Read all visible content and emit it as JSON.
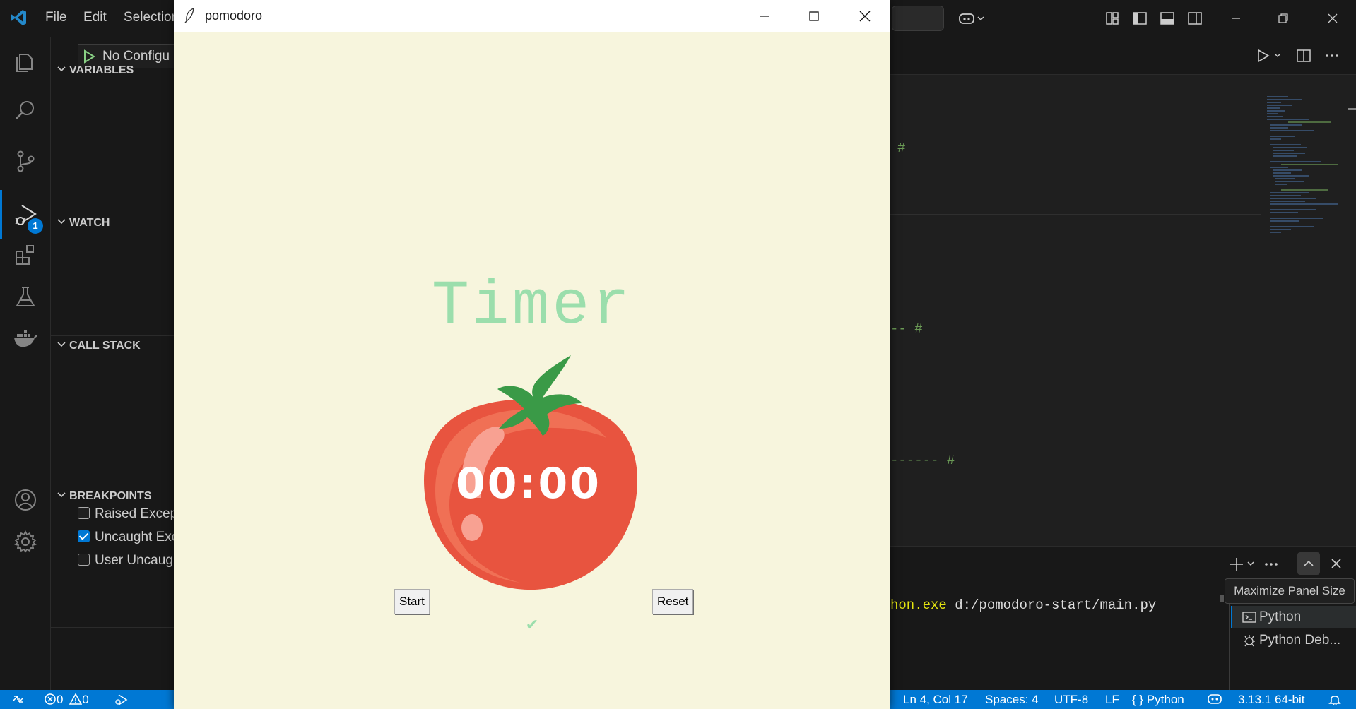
{
  "vscode": {
    "menu": [
      "File",
      "Edit",
      "Selection"
    ],
    "run_config": "No Configu",
    "sidebar": {
      "variables": "VARIABLES",
      "watch": "WATCH",
      "call_stack": "CALL STACK",
      "breakpoints": "BREAKPOINTS",
      "breakpoint_items": [
        {
          "label": "Raised Excep",
          "checked": false
        },
        {
          "label": "Uncaught Exc",
          "checked": true
        },
        {
          "label": "User Uncaug",
          "checked": false
        }
      ]
    },
    "activity_badge": "1",
    "editor_fragments": [
      "#",
      "-- #",
      "------ #"
    ],
    "terminal": {
      "command_exe": "hon.exe",
      "command_arg": " d:/pomodoro-start/main.py",
      "tooltip": "Maximize Panel Size",
      "items": [
        "Python",
        "Python Deb..."
      ]
    },
    "status": {
      "errors": "0",
      "warnings": "0",
      "position": "Ln 4, Col 17",
      "spaces": "Spaces: 4",
      "encoding": "UTF-8",
      "eol": "LF",
      "language": "Python",
      "interpreter": "3.13.1 64-bit"
    }
  },
  "pomodoro": {
    "window_title": "pomodoro",
    "label": "Timer",
    "time": "00:00",
    "start_label": "Start",
    "reset_label": "Reset",
    "checkmark": "✔"
  },
  "colors": {
    "accent": "#0078d4",
    "pomodoro_bg": "#f7f5dd",
    "timer_green": "#9bdeac",
    "tomato": "#e8543f"
  }
}
